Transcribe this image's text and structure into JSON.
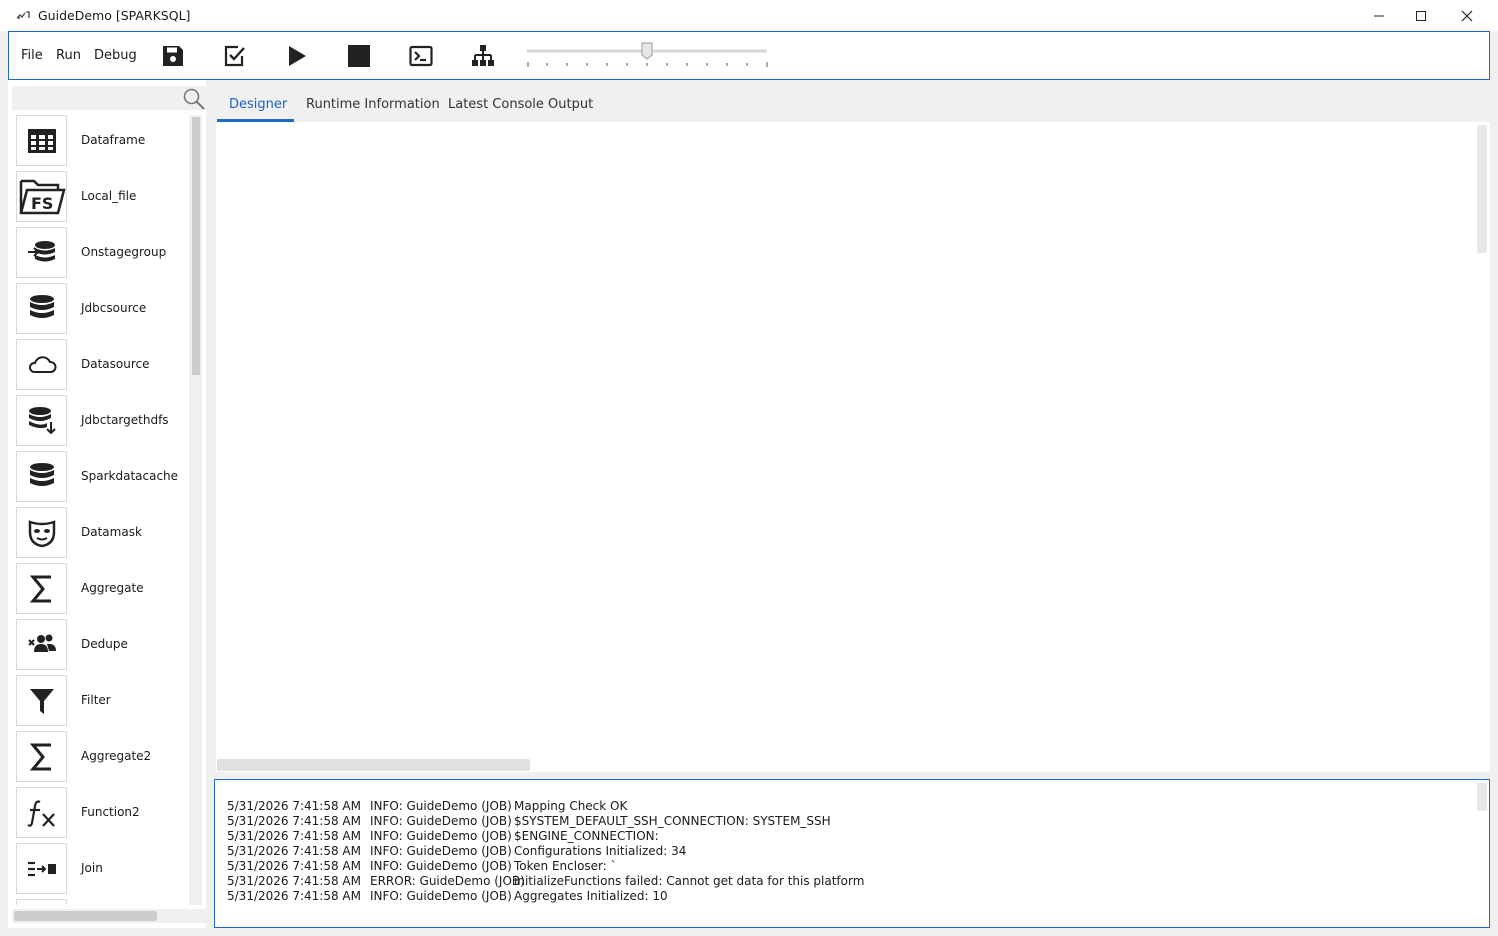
{
  "window": {
    "title": "GuideDemo [SPARKSQL]"
  },
  "menu": {
    "file": "File",
    "run": "Run",
    "debug": "Debug"
  },
  "toolbar": {
    "icons": [
      "save-icon",
      "check-icon",
      "play-icon",
      "stop-icon",
      "console-icon",
      "hierarchy-icon"
    ],
    "zoom_slider_level": 0.5
  },
  "palette": {
    "search": {
      "value": "",
      "placeholder": ""
    },
    "items": [
      {
        "label": "Dataframe",
        "icon": "grid-icon"
      },
      {
        "label": "Local_file",
        "icon": "fs-folder-icon"
      },
      {
        "label": "Onstagegroup",
        "icon": "database-in-icon"
      },
      {
        "label": "Jdbcsource",
        "icon": "database-icon"
      },
      {
        "label": "Datasource",
        "icon": "cloud-icon"
      },
      {
        "label": "Jdbctargethdfs",
        "icon": "database-download-icon"
      },
      {
        "label": "Sparkdatacache",
        "icon": "database-icon"
      },
      {
        "label": "Datamask",
        "icon": "mask-icon"
      },
      {
        "label": "Aggregate",
        "icon": "sigma-icon"
      },
      {
        "label": "Dedupe",
        "icon": "people-remove-icon"
      },
      {
        "label": "Filter",
        "icon": "filter-icon"
      },
      {
        "label": "Aggregate2",
        "icon": "sigma-icon"
      },
      {
        "label": "Function2",
        "icon": "function-icon"
      },
      {
        "label": "Join",
        "icon": "join-icon"
      }
    ]
  },
  "tabs": [
    {
      "label": "Designer",
      "active": true
    },
    {
      "label": "Runtime Information",
      "active": false
    },
    {
      "label": "Latest Console Output",
      "active": false
    }
  ],
  "console": {
    "lines": [
      {
        "ts": "5/31/2026 7:41:58 AM",
        "level": "INFO: GuideDemo (JOB)",
        "msg": "Mapping Check OK"
      },
      {
        "ts": "5/31/2026 7:41:58 AM",
        "level": "INFO: GuideDemo (JOB)",
        "msg": "$SYSTEM_DEFAULT_SSH_CONNECTION: SYSTEM_SSH"
      },
      {
        "ts": "5/31/2026 7:41:58 AM",
        "level": "INFO: GuideDemo (JOB)",
        "msg": "$ENGINE_CONNECTION:"
      },
      {
        "ts": "5/31/2026 7:41:58 AM",
        "level": "INFO: GuideDemo (JOB)",
        "msg": "Configurations Initialized: 34"
      },
      {
        "ts": "5/31/2026 7:41:58 AM",
        "level": "INFO: GuideDemo (JOB)",
        "msg": "Token Encloser: `"
      },
      {
        "ts": "5/31/2026 7:41:58 AM",
        "level": "ERROR: GuideDemo (JOB)",
        "msg": "initializeFunctions failed: Cannot get data for this platform"
      },
      {
        "ts": "5/31/2026 7:41:58 AM",
        "level": "INFO: GuideDemo (JOB)",
        "msg": "Aggregates Initialized: 10"
      }
    ]
  }
}
